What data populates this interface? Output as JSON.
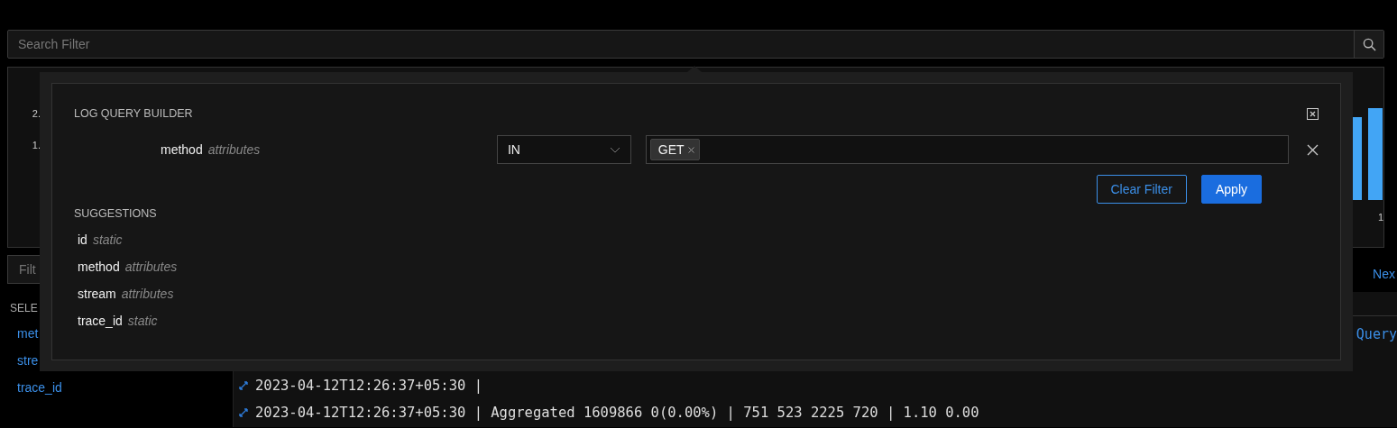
{
  "search": {
    "placeholder": "Search Filter"
  },
  "chart": {
    "tick_labels": [
      "2.",
      "1."
    ],
    "x_label": "1"
  },
  "filter": {
    "placeholder": "Filt"
  },
  "pager": {
    "next": "Nex"
  },
  "sidebar": {
    "heading": "SELE",
    "fields": [
      "met",
      "stre",
      "trace_id"
    ]
  },
  "query_link": "Query",
  "log_rows": [
    "2023-04-12T12:26:37+05:30 |",
    "2023-04-12T12:26:37+05:30 | Aggregated 1609866 0(0.00%) | 751 523 2225 720 | 1.10 0.00"
  ],
  "query_builder": {
    "title": "LOG QUERY BUILDER",
    "condition": {
      "field": "method",
      "field_type": "attributes",
      "operator": "IN",
      "values": [
        "GET"
      ]
    },
    "buttons": {
      "clear": "Clear Filter",
      "apply": "Apply"
    },
    "suggestions_title": "SUGGESTIONS",
    "suggestions": [
      {
        "field": "id",
        "type": "static"
      },
      {
        "field": "method",
        "type": "attributes"
      },
      {
        "field": "stream",
        "type": "attributes"
      },
      {
        "field": "trace_id",
        "type": "static"
      }
    ]
  }
}
